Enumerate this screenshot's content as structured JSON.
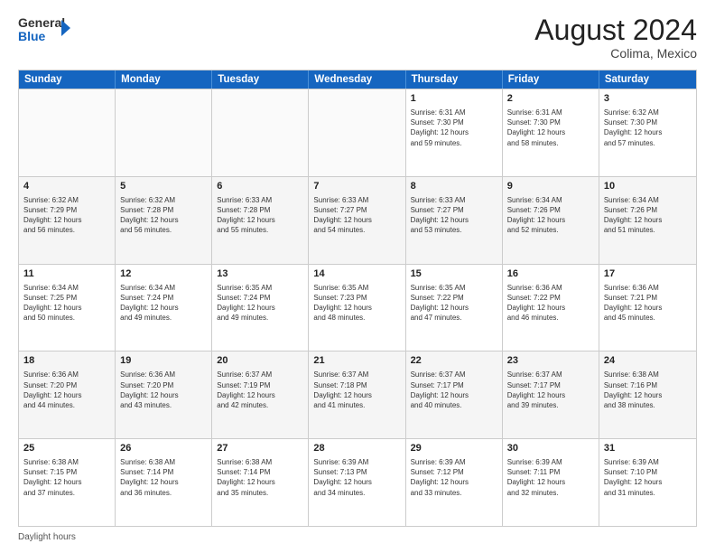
{
  "logo": {
    "general": "General",
    "blue": "Blue"
  },
  "title": {
    "month_year": "August 2024",
    "location": "Colima, Mexico"
  },
  "header_days": [
    "Sunday",
    "Monday",
    "Tuesday",
    "Wednesday",
    "Thursday",
    "Friday",
    "Saturday"
  ],
  "rows": [
    [
      {
        "day": "",
        "info": ""
      },
      {
        "day": "",
        "info": ""
      },
      {
        "day": "",
        "info": ""
      },
      {
        "day": "",
        "info": ""
      },
      {
        "day": "1",
        "info": "Sunrise: 6:31 AM\nSunset: 7:30 PM\nDaylight: 12 hours\nand 59 minutes."
      },
      {
        "day": "2",
        "info": "Sunrise: 6:31 AM\nSunset: 7:30 PM\nDaylight: 12 hours\nand 58 minutes."
      },
      {
        "day": "3",
        "info": "Sunrise: 6:32 AM\nSunset: 7:30 PM\nDaylight: 12 hours\nand 57 minutes."
      }
    ],
    [
      {
        "day": "4",
        "info": "Sunrise: 6:32 AM\nSunset: 7:29 PM\nDaylight: 12 hours\nand 56 minutes."
      },
      {
        "day": "5",
        "info": "Sunrise: 6:32 AM\nSunset: 7:28 PM\nDaylight: 12 hours\nand 56 minutes."
      },
      {
        "day": "6",
        "info": "Sunrise: 6:33 AM\nSunset: 7:28 PM\nDaylight: 12 hours\nand 55 minutes."
      },
      {
        "day": "7",
        "info": "Sunrise: 6:33 AM\nSunset: 7:27 PM\nDaylight: 12 hours\nand 54 minutes."
      },
      {
        "day": "8",
        "info": "Sunrise: 6:33 AM\nSunset: 7:27 PM\nDaylight: 12 hours\nand 53 minutes."
      },
      {
        "day": "9",
        "info": "Sunrise: 6:34 AM\nSunset: 7:26 PM\nDaylight: 12 hours\nand 52 minutes."
      },
      {
        "day": "10",
        "info": "Sunrise: 6:34 AM\nSunset: 7:26 PM\nDaylight: 12 hours\nand 51 minutes."
      }
    ],
    [
      {
        "day": "11",
        "info": "Sunrise: 6:34 AM\nSunset: 7:25 PM\nDaylight: 12 hours\nand 50 minutes."
      },
      {
        "day": "12",
        "info": "Sunrise: 6:34 AM\nSunset: 7:24 PM\nDaylight: 12 hours\nand 49 minutes."
      },
      {
        "day": "13",
        "info": "Sunrise: 6:35 AM\nSunset: 7:24 PM\nDaylight: 12 hours\nand 49 minutes."
      },
      {
        "day": "14",
        "info": "Sunrise: 6:35 AM\nSunset: 7:23 PM\nDaylight: 12 hours\nand 48 minutes."
      },
      {
        "day": "15",
        "info": "Sunrise: 6:35 AM\nSunset: 7:22 PM\nDaylight: 12 hours\nand 47 minutes."
      },
      {
        "day": "16",
        "info": "Sunrise: 6:36 AM\nSunset: 7:22 PM\nDaylight: 12 hours\nand 46 minutes."
      },
      {
        "day": "17",
        "info": "Sunrise: 6:36 AM\nSunset: 7:21 PM\nDaylight: 12 hours\nand 45 minutes."
      }
    ],
    [
      {
        "day": "18",
        "info": "Sunrise: 6:36 AM\nSunset: 7:20 PM\nDaylight: 12 hours\nand 44 minutes."
      },
      {
        "day": "19",
        "info": "Sunrise: 6:36 AM\nSunset: 7:20 PM\nDaylight: 12 hours\nand 43 minutes."
      },
      {
        "day": "20",
        "info": "Sunrise: 6:37 AM\nSunset: 7:19 PM\nDaylight: 12 hours\nand 42 minutes."
      },
      {
        "day": "21",
        "info": "Sunrise: 6:37 AM\nSunset: 7:18 PM\nDaylight: 12 hours\nand 41 minutes."
      },
      {
        "day": "22",
        "info": "Sunrise: 6:37 AM\nSunset: 7:17 PM\nDaylight: 12 hours\nand 40 minutes."
      },
      {
        "day": "23",
        "info": "Sunrise: 6:37 AM\nSunset: 7:17 PM\nDaylight: 12 hours\nand 39 minutes."
      },
      {
        "day": "24",
        "info": "Sunrise: 6:38 AM\nSunset: 7:16 PM\nDaylight: 12 hours\nand 38 minutes."
      }
    ],
    [
      {
        "day": "25",
        "info": "Sunrise: 6:38 AM\nSunset: 7:15 PM\nDaylight: 12 hours\nand 37 minutes."
      },
      {
        "day": "26",
        "info": "Sunrise: 6:38 AM\nSunset: 7:14 PM\nDaylight: 12 hours\nand 36 minutes."
      },
      {
        "day": "27",
        "info": "Sunrise: 6:38 AM\nSunset: 7:14 PM\nDaylight: 12 hours\nand 35 minutes."
      },
      {
        "day": "28",
        "info": "Sunrise: 6:39 AM\nSunset: 7:13 PM\nDaylight: 12 hours\nand 34 minutes."
      },
      {
        "day": "29",
        "info": "Sunrise: 6:39 AM\nSunset: 7:12 PM\nDaylight: 12 hours\nand 33 minutes."
      },
      {
        "day": "30",
        "info": "Sunrise: 6:39 AM\nSunset: 7:11 PM\nDaylight: 12 hours\nand 32 minutes."
      },
      {
        "day": "31",
        "info": "Sunrise: 6:39 AM\nSunset: 7:10 PM\nDaylight: 12 hours\nand 31 minutes."
      }
    ]
  ],
  "footer": {
    "daylight_label": "Daylight hours"
  }
}
